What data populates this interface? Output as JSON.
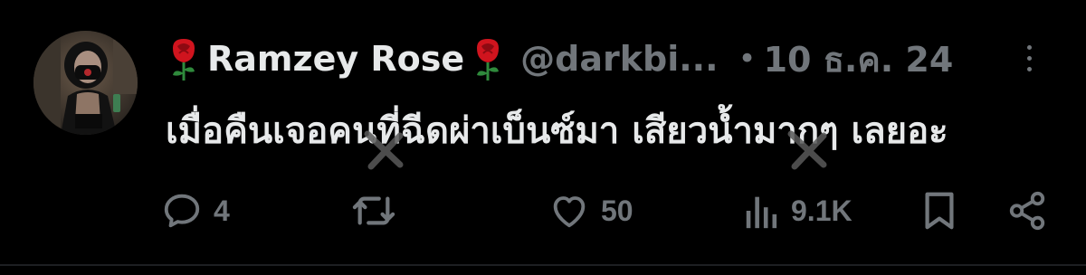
{
  "tweet": {
    "author": {
      "display_name": "Ramzey Rose",
      "handle": "@darkbi...",
      "avatar_icon": "profile-photo"
    },
    "separator": "•",
    "timestamp": "10 ธ.ค. 24",
    "text": "เมื่อคืนเจอคนที่ฉีดผ่าเบ็นซ์มา เสียวน้ำมากๆ เลยอะ",
    "actions": {
      "replies": "4",
      "retweets": "",
      "likes": "50",
      "views": "9.1K"
    }
  },
  "colors": {
    "background": "#000000",
    "text_primary": "#e7e9ea",
    "text_secondary": "#71767b",
    "rose": "#d0141e"
  }
}
